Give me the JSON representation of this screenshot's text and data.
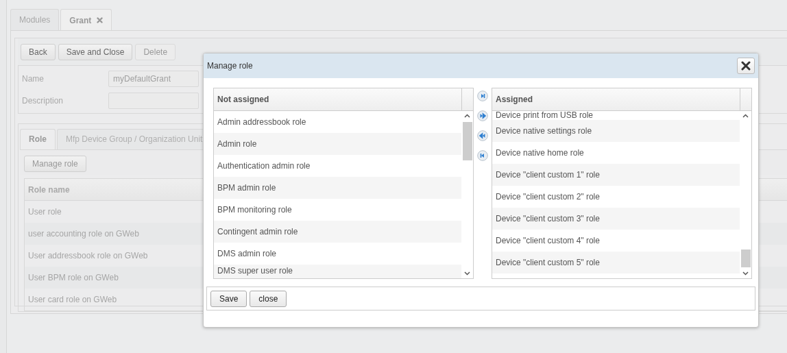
{
  "tabs": [
    {
      "label": "Modules",
      "selected": false,
      "closable": false
    },
    {
      "label": "Grant",
      "selected": true,
      "closable": true
    }
  ],
  "toolbar": {
    "buttons": [
      {
        "label": "Back",
        "disabled": false
      },
      {
        "label": "Save and Close",
        "disabled": false
      },
      {
        "label": "Delete",
        "disabled": true
      }
    ]
  },
  "form": {
    "fields": [
      {
        "label": "Name",
        "value": "myDefaultGrant"
      },
      {
        "label": "Description"
      }
    ]
  },
  "subtabs": [
    {
      "label": "Role",
      "selected": true
    },
    {
      "label": "Mfp Device Group / Organization Unit",
      "selected": false
    }
  ],
  "manage_button": "Manage role",
  "table": {
    "columns": [
      "Role name"
    ],
    "rows": [
      "User role",
      "user accounting role on GWeb",
      "User addressbook role on GWeb",
      "User BPM role on GWeb",
      "User card role on GWeb"
    ]
  },
  "dialog": {
    "title": "Manage role",
    "not_assigned": {
      "header": "Not assigned",
      "items": [
        "Admin addressbook role",
        "Admin role",
        "Authentication admin role",
        "BPM admin role",
        "BPM monitoring role",
        "Contingent admin role",
        "DMS admin role",
        "DMS super user role"
      ]
    },
    "assigned": {
      "header": "Assigned",
      "items": [
        "Device print from USB role",
        "Device native settings role",
        "Device native home role",
        "Device \"client custom 1\" role",
        "Device \"client custom 2\" role",
        "Device \"client custom 3\" role",
        "Device \"client custom 4\" role",
        "Device \"client custom 5\" role"
      ]
    },
    "buttons": [
      "Save",
      "close"
    ]
  }
}
